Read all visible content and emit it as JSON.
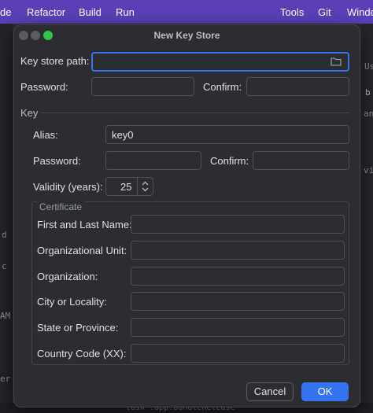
{
  "menubar": {
    "items": [
      "de",
      "Refactor",
      "Build",
      "Run",
      "Tools",
      "Git",
      "Windo"
    ]
  },
  "ide": {
    "fragments": [
      "Us",
      "b",
      "an",
      "vi",
      "d",
      "c",
      "AM",
      "er"
    ],
    "bottom_text": "task :app:bundleRelease"
  },
  "dialog": {
    "title": "New Key Store",
    "keystore": {
      "path_label": "Key store path:",
      "path_value": "",
      "password_label": "Password:",
      "confirm_label": "Confirm:"
    },
    "key_section_label": "Key",
    "key": {
      "alias_label": "Alias:",
      "alias_value": "key0",
      "password_label": "Password:",
      "confirm_label": "Confirm:",
      "validity_label": "Validity (years):",
      "validity_value": "25"
    },
    "certificate": {
      "title": "Certificate",
      "fields": [
        {
          "label": "First and Last Name:",
          "value": ""
        },
        {
          "label": "Organizational Unit:",
          "value": ""
        },
        {
          "label": "Organization:",
          "value": ""
        },
        {
          "label": "City or Locality:",
          "value": ""
        },
        {
          "label": "State or Province:",
          "value": ""
        },
        {
          "label": "Country Code (XX):",
          "value": ""
        }
      ]
    },
    "buttons": {
      "cancel": "Cancel",
      "ok": "OK"
    }
  },
  "colors": {
    "accent": "#3574f0",
    "menubar": "#5b3fb6",
    "dialog_bg": "#2b2d30"
  },
  "icons": [
    "folder-icon",
    "spinner-up-icon",
    "spinner-down-icon"
  ]
}
